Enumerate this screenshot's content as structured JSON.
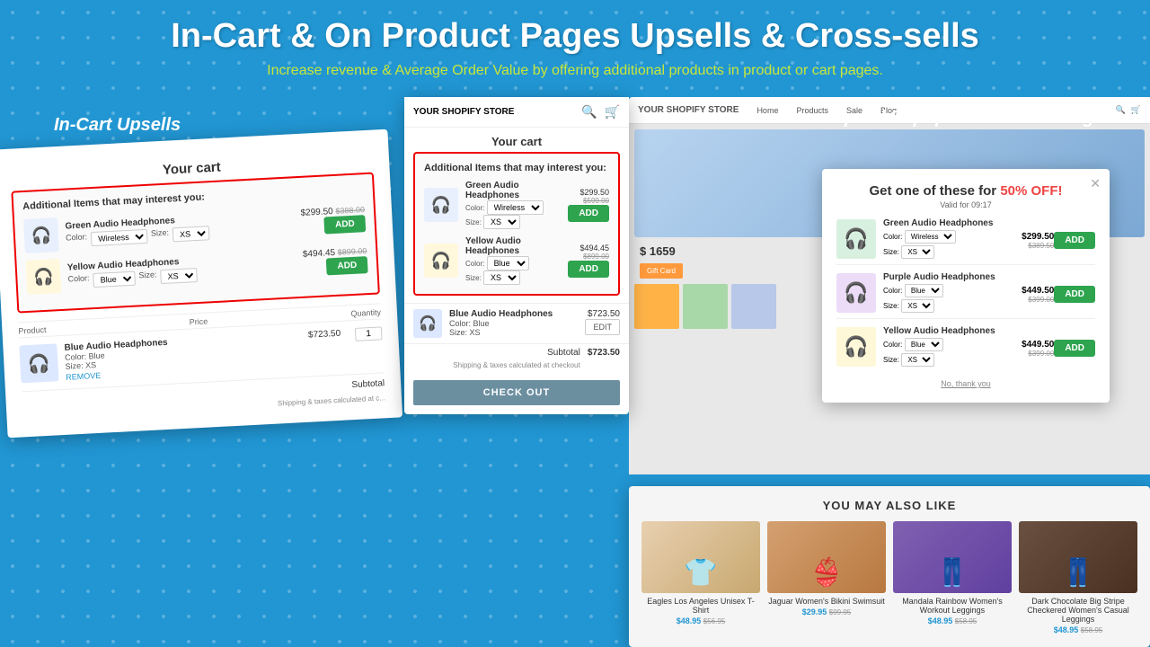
{
  "header": {
    "title": "In-Cart & On Product Pages Upsells & Cross-sells",
    "subtitle": "Increase revenue & Average Order Value by offering additional products in product or cart pages."
  },
  "labels": {
    "in_cart": "In-Cart Upsells",
    "upsell_popup": "Upsell Popups on Product Pages"
  },
  "left_card": {
    "title": "Your cart",
    "upsell_header": "Additional Items that may interest you:",
    "items": [
      {
        "name": "Green Audio Headphones",
        "color_label": "Color:",
        "color_value": "Wireless",
        "size_label": "Size:",
        "size_value": "XS",
        "price": "$299.50",
        "price_original": "$388.00",
        "btn": "ADD"
      },
      {
        "name": "Yellow Audio Headphones",
        "color_label": "Color:",
        "color_value": "Blue",
        "size_label": "Size:",
        "size_value": "XS",
        "price": "$494.45",
        "price_original": "$899.00",
        "btn": "ADD"
      }
    ],
    "cart_headers": [
      "Product",
      "Price",
      "Quantity"
    ],
    "cart_item": {
      "name": "Blue Audio Headphones",
      "color": "Color: Blue",
      "size": "Size: XS",
      "price": "$723.50",
      "qty": "1",
      "remove": "REMOVE"
    },
    "subtotal_label": "Subtotal",
    "subtotal_value": "",
    "shipping_note": "Shipping & taxes calculated at c..."
  },
  "middle_card": {
    "store_name": "YOUR SHOPIFY STORE",
    "title": "Your cart",
    "upsell_header": "Additional Items that may interest you:",
    "items": [
      {
        "name": "Green Audio Headphones",
        "color_label": "Color:",
        "color_value": "Wireless",
        "size_label": "Size:",
        "size_value": "XS",
        "price": "$299.50",
        "price_original": "$599.00",
        "btn": "ADD"
      },
      {
        "name": "Yellow Audio Headphones",
        "color_label": "Color:",
        "color_value": "Blue",
        "size_label": "Size:",
        "size_value": "XS",
        "price": "$494.45",
        "price_original": "$899.00",
        "btn": "ADD"
      }
    ],
    "cart_item": {
      "name": "Blue Audio Headphones",
      "color": "Color: Blue",
      "size": "Size: XS",
      "price": "$723.50",
      "btn": "EDIT"
    },
    "subtotal_label": "Subtotal",
    "subtotal_value": "$723.50",
    "shipping_note": "Shipping & taxes calculated at checkout",
    "checkout_btn": "CHECK OUT"
  },
  "popup_card": {
    "title": "Get one of these for",
    "highlight": "50% OFF!",
    "timer_label": "Valid for",
    "timer_value": "09:17",
    "items": [
      {
        "name": "Green Audio Headphones",
        "color_label": "Color:",
        "color_value": "Wireless",
        "size_label": "Size:",
        "size_value": "XS",
        "price": "$299.50",
        "price_original": "$389.50",
        "btn": "ADD",
        "emoji": "🎧",
        "color_class": "green"
      },
      {
        "name": "Purple Audio Headphones",
        "color_label": "Color:",
        "color_value": "Blue",
        "size_label": "Size:",
        "size_value": "XS",
        "price": "$449.50",
        "price_original": "$399.00",
        "btn": "ADD",
        "emoji": "🎧",
        "color_class": "purple"
      },
      {
        "name": "Yellow Audio Headphones",
        "color_label": "Color:",
        "color_value": "Blue",
        "size_label": "Size:",
        "size_value": "XS",
        "price": "$449.50",
        "price_original": "$399.00",
        "btn": "ADD",
        "emoji": "🎧",
        "color_class": "yellow"
      }
    ],
    "no_thanks": "No, thank you"
  },
  "ymal": {
    "title": "YOU MAY ALSO LIKE",
    "products": [
      {
        "name": "Eagles Los Angeles Unisex T-Shirt",
        "price_new": "$48.95",
        "price_old": "$56.95",
        "color": "#e8c8b0"
      },
      {
        "name": "Jaguar Women's Bikini Swimsuit",
        "price_new": "$29.95",
        "price_old": "$99.95",
        "color": "#d4a070"
      },
      {
        "name": "Mandala Rainbow Women's Workout Leggings",
        "price_new": "$48.95",
        "price_old": "$58.95",
        "color": "#7a60a0"
      },
      {
        "name": "Dark Chocolate Big Stripe Checkered Women's Casual Leggings",
        "price_new": "$48.95",
        "price_old": "$58.95",
        "color": "#5a4030"
      }
    ]
  }
}
